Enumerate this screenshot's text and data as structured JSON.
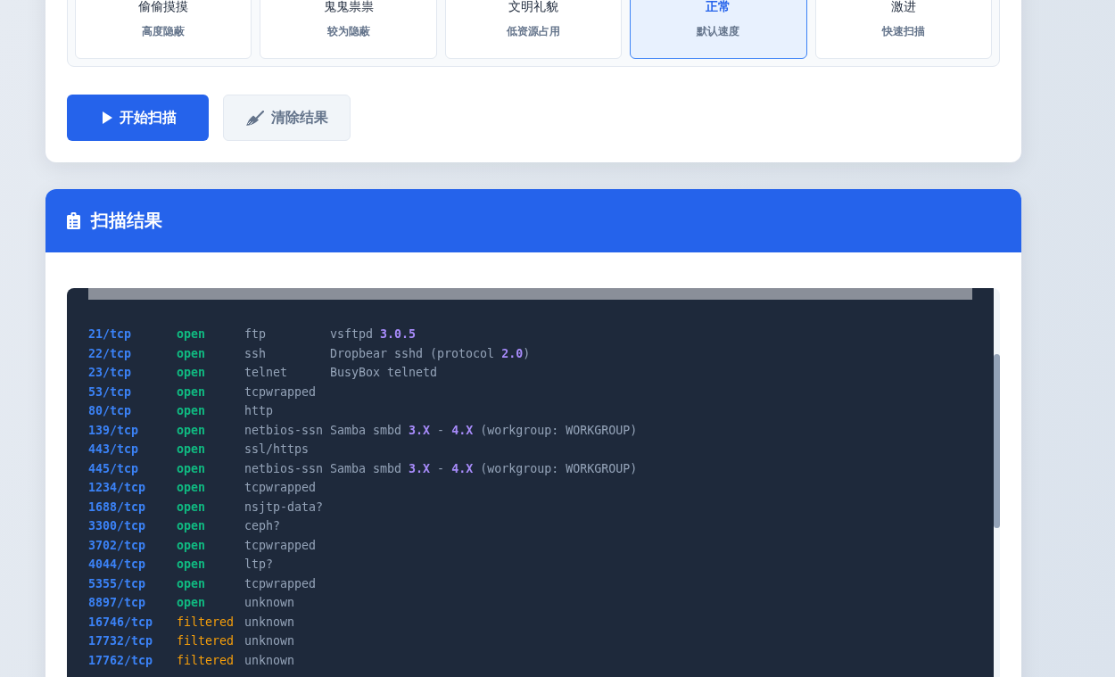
{
  "speed_selector": {
    "options": [
      {
        "title": "偷偷摸摸",
        "subtitle": "高度隐蔽",
        "selected": false
      },
      {
        "title": "鬼鬼祟祟",
        "subtitle": "较为隐蔽",
        "selected": false
      },
      {
        "title": "文明礼貌",
        "subtitle": "低资源占用",
        "selected": false
      },
      {
        "title": "正常",
        "subtitle": "默认速度",
        "selected": true
      },
      {
        "title": "激进",
        "subtitle": "快速扫描",
        "selected": false
      }
    ]
  },
  "actions": [
    {
      "label": "开始扫描",
      "kind": "primary"
    },
    {
      "label": "清除结果",
      "kind": "secondary"
    }
  ],
  "results": {
    "title": "扫描结果",
    "rows": [
      {
        "port": "21/tcp",
        "state": "open",
        "kind": "open",
        "service": "ftp",
        "version": "vsftpd **3.0.5**"
      },
      {
        "port": "22/tcp",
        "state": "open",
        "kind": "open",
        "service": "ssh",
        "version": "Dropbear sshd (protocol **2.0**)"
      },
      {
        "port": "23/tcp",
        "state": "open",
        "kind": "open",
        "service": "telnet",
        "version": "BusyBox telnetd"
      },
      {
        "port": "53/tcp",
        "state": "open",
        "kind": "open",
        "service": "tcpwrapped"
      },
      {
        "port": "80/tcp",
        "state": "open",
        "kind": "open",
        "service": "http"
      },
      {
        "port": "139/tcp",
        "state": "open",
        "kind": "open",
        "service": "netbios-ssn",
        "version": "Samba smbd **3.X** - **4.X** (workgroup: WORKGROUP)"
      },
      {
        "port": "443/tcp",
        "state": "open",
        "kind": "open",
        "service": "ssl/https"
      },
      {
        "port": "445/tcp",
        "state": "open",
        "kind": "open",
        "service": "netbios-ssn",
        "version": "Samba smbd **3.X** - **4.X** (workgroup: WORKGROUP)"
      },
      {
        "port": "1234/tcp",
        "state": "open",
        "kind": "open",
        "service": "tcpwrapped"
      },
      {
        "port": "1688/tcp",
        "state": "open",
        "kind": "open",
        "service": "nsjtp-data?"
      },
      {
        "port": "3300/tcp",
        "state": "open",
        "kind": "open",
        "service": "ceph?"
      },
      {
        "port": "3702/tcp",
        "state": "open",
        "kind": "open",
        "service": "tcpwrapped"
      },
      {
        "port": "4044/tcp",
        "state": "open",
        "kind": "open",
        "service": "ltp?"
      },
      {
        "port": "5355/tcp",
        "state": "open",
        "kind": "open",
        "service": "tcpwrapped"
      },
      {
        "port": "8897/tcp",
        "state": "open",
        "kind": "open",
        "service": "unknown"
      },
      {
        "port": "16746/tcp",
        "state": "filtered",
        "kind": "filtered",
        "service": "unknown"
      },
      {
        "port": "17732/tcp",
        "state": "filtered",
        "kind": "filtered",
        "service": "unknown"
      },
      {
        "port": "17762/tcp",
        "state": "filtered",
        "kind": "filtered",
        "service": "unknown"
      }
    ]
  }
}
